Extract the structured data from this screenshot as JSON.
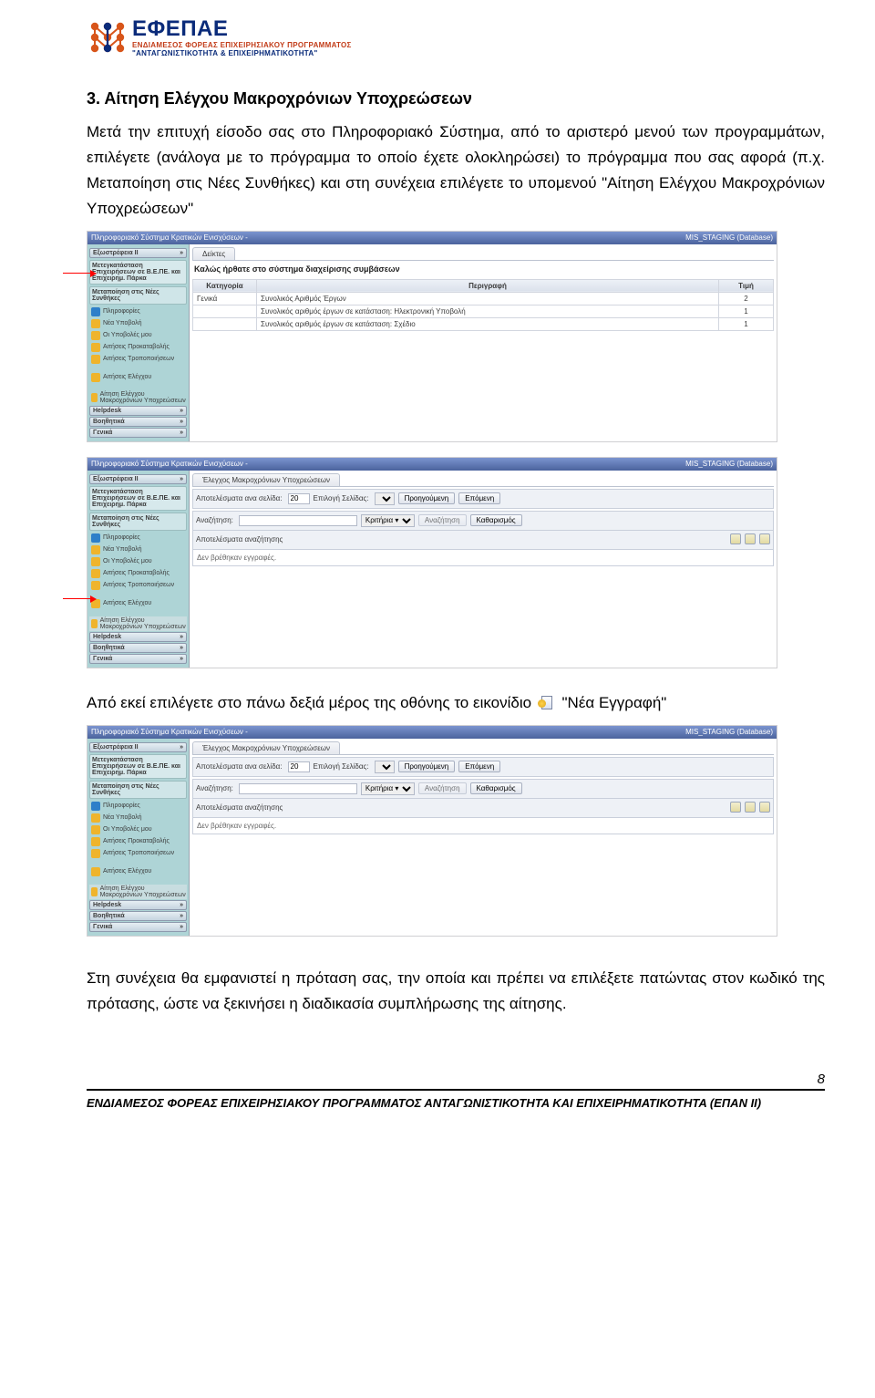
{
  "logo": {
    "line1": "ΕΦΕΠΑΕ",
    "line2": "ΕΝΔΙΑΜΕΣΟΣ ΦΟΡΕΑΣ ΕΠΙΧΕΙΡΗΣΙΑΚΟΥ ΠΡΟΓΡΑΜΜΑΤΟΣ",
    "line3": "\"ΑΝΤΑΓΩΝΙΣΤΙΚΟΤΗΤΑ & ΕΠΙΧΕΙΡΗΜΑΤΙΚΟΤΗΤΑ\""
  },
  "heading": "3. Αίτηση Ελέγχου Μακροχρόνιων Υποχρεώσεων",
  "para1": "Μετά την επιτυχή είσοδο σας στο Πληροφοριακό Σύστημα, από το αριστερό μενού των προγραμμάτων, επιλέγετε (ανάλογα με το πρόγραμμα το οποίο έχετε ολοκληρώσει) το πρόγραμμα που σας αφορά (π.χ. Μεταποίηση στις Νέες Συνθήκες) και στη συνέχεια επιλέγετε το υπομενού \"Αίτηση Ελέγχου Μακροχρόνιων Υποχρεώσεων\"",
  "para2_a": "Από εκεί επιλέγετε στο πάνω δεξιά μέρος της οθόνης το εικονίδιο ",
  "para2_b": " \"Νέα Εγγραφή\"",
  "para3": "Στη συνέχεια θα εμφανιστεί η πρόταση σας, την οποία και πρέπει να επιλέξετε πατώντας στον κωδικό της πρότασης, ώστε να ξεκινήσει η διαδικασία συμπλήρωσης της αίτησης.",
  "shot1": {
    "title_left": "Πληροφοριακό Σύστημα Κρατικών Ενισχύσεων -",
    "title_right": "MIS_STAGING (Database)",
    "sidebar": {
      "acc1": "Εξωστρέφεια II",
      "sub1": "Μετεγκατάσταση Επιχειρήσεων σε Β.Ε.ΠΕ. και Επιχειρημ. Πάρκα",
      "sub2": "Μεταποίηση στις Νέες Συνθήκες",
      "items": [
        {
          "label": "Πληροφορίες"
        },
        {
          "label": "Νέα Υποβολή"
        },
        {
          "label": "Οι Υποβολές μου"
        },
        {
          "label": "Αιτήσεις Προκαταβολής"
        },
        {
          "label": "Αιτήσεις Τροποποιήσεων"
        }
      ],
      "item_gap": "Αιτήσεις Ελέγχου",
      "item_last": "Αίτηση Ελέγχου Μακροχρόνιων Υποχρεώσεων",
      "acc2": "Helpdesk",
      "acc3": "Βοηθητικά",
      "acc4": "Γενικά"
    },
    "tab": "Δείκτες",
    "welcome": "Καλώς ήρθατε στο σύστημα διαχείρισης συμβάσεων",
    "table": {
      "headers": [
        "Κατηγορία",
        "Περιγραφή",
        "Τιμή"
      ],
      "rows": [
        [
          "Γενικά",
          "Συνολικός Αριθμός Έργων",
          "2"
        ],
        [
          "",
          "Συνολικός αριθμός έργων σε κατάσταση: Ηλεκτρονική Υποβολή",
          "1"
        ],
        [
          "",
          "Συνολικός αριθμός έργων σε κατάσταση: Σχέδιο",
          "1"
        ]
      ]
    }
  },
  "shot2": {
    "title_left": "Πληροφοριακό Σύστημα Κρατικών Ενισχύσεων -",
    "title_right": "MIS_STAGING (Database)",
    "tab": "Έλεγχος Μακροχρόνιων Υποχρεώσεων",
    "toolbar": {
      "results": "Αποτελέσματα ανα σελίδα:",
      "perpage": "20",
      "pagesel": "Επιλογή Σελίδας:",
      "prev": "Προηγούμενη",
      "next": "Επόμενη",
      "search": "Αναζήτηση:",
      "criteria": "Κριτήρια ▾",
      "go": "Αναζήτηση",
      "clear": "Καθαρισμός"
    },
    "resultbar": "Αποτελέσματα αναζήτησης",
    "empty": "Δεν βρέθηκαν εγγραφές."
  },
  "shot3": {
    "title_left": "Πληροφοριακό Σύστημα Κρατικών Ενισχύσεων -",
    "title_right": "MIS_STAGING (Database)",
    "tab": "Έλεγχος Μακροχρόνιων Υποχρεώσεων",
    "toolbar": {
      "results": "Αποτελέσματα ανα σελίδα:",
      "perpage": "20",
      "pagesel": "Επιλογή Σελίδας:",
      "prev": "Προηγούμενη",
      "next": "Επόμενη",
      "search": "Αναζήτηση:",
      "criteria": "Κριτήρια ▾",
      "go": "Αναζήτηση",
      "clear": "Καθαρισμός"
    },
    "resultbar": "Αποτελέσματα αναζήτησης",
    "empty": "Δεν βρέθηκαν εγγραφές."
  },
  "pgnum": "8",
  "footer": "ΕΝΔΙΑΜΕΣΟΣ ΦΟΡΕΑΣ ΕΠΙΧΕΙΡΗΣΙΑΚΟΥ ΠΡΟΓΡΑΜΜΑΤΟΣ ΑΝΤΑΓΩΝΙΣΤΙΚΟΤΗΤΑ ΚΑΙ ΕΠΙΧΕΙΡΗΜΑΤΙΚΟΤΗΤΑ (ΕΠΑΝ ΙΙ)"
}
